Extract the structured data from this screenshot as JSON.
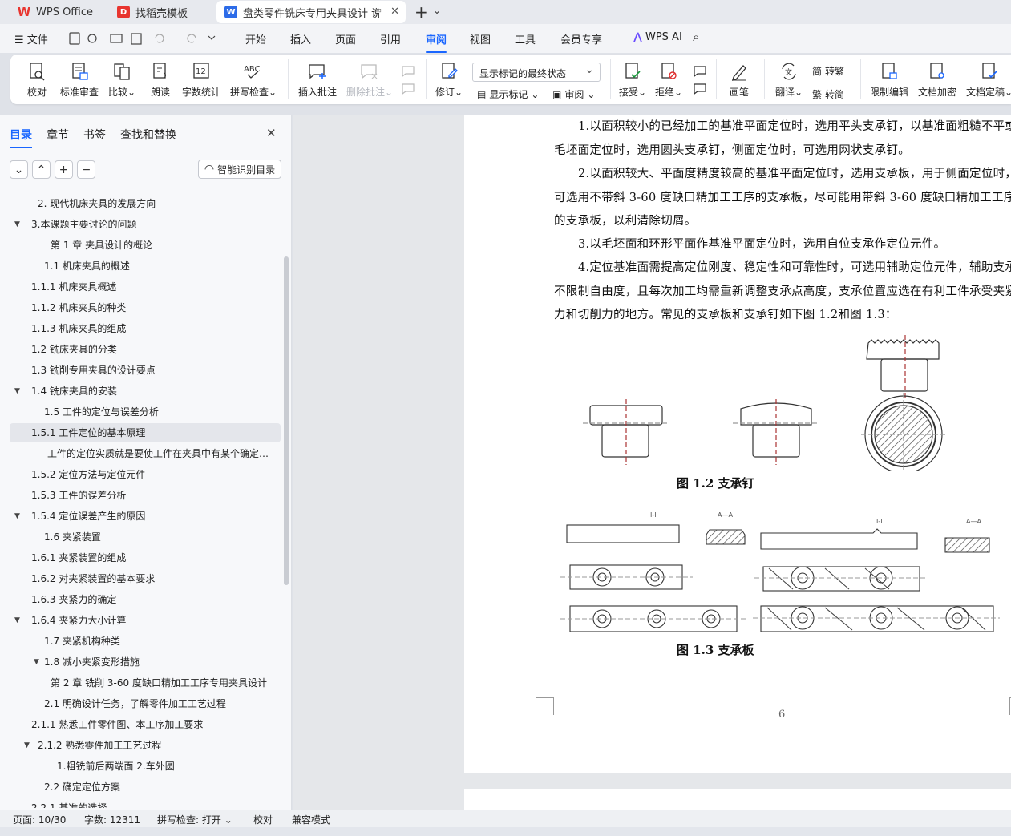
{
  "tabs": [
    {
      "label": "WPS Office",
      "icon": "wps-logo-icon",
      "color": "#e8352f"
    },
    {
      "label": "找稻壳模板",
      "icon": "docer-icon",
      "color": "#e8352f"
    },
    {
      "label": "盘类零件铣床专用夹具设计 说",
      "icon": "word-doc-icon",
      "color": "#2d6ce8"
    }
  ],
  "menu": {
    "file": "文件",
    "items": [
      "开始",
      "插入",
      "页面",
      "引用",
      "审阅",
      "视图",
      "工具",
      "会员专享"
    ],
    "active": "审阅",
    "ai": "WPS AI"
  },
  "ribbon": {
    "proof": "校对",
    "std_review": "标准审查",
    "compare": "比较",
    "read_aloud": "朗读",
    "word_count": "字数统计",
    "spell_check": "拼写检查",
    "insert_comment": "插入批注",
    "delete_comment": "删除批注",
    "revise": "修订",
    "markup_state": "显示标记的最终状态",
    "show_markup": "显示标记",
    "review": "审阅",
    "accept": "接受",
    "reject": "拒绝",
    "pen": "画笔",
    "translate": "翻译",
    "to_traditional": "转繁",
    "to_simplified": "转简",
    "restrict_edit": "限制编辑",
    "doc_encrypt": "文档加密",
    "doc_finalize": "文档定稿"
  },
  "nav": {
    "tabs": [
      "目录",
      "章节",
      "书签",
      "查找和替换"
    ],
    "active": "目录",
    "smart_btn": "智能识别目录",
    "toc": [
      {
        "text": "2. 现代机床夹具的发展方向",
        "indent": 2,
        "tw": ""
      },
      {
        "text": "3.本课题主要讨论的问题",
        "indent": 1,
        "tw": "▼"
      },
      {
        "text": "第 1 章  夹具设计的概论",
        "indent": 4,
        "tw": ""
      },
      {
        "text": "1.1  机床夹具的概述",
        "indent": 3,
        "tw": ""
      },
      {
        "text": "1.1.1    机床夹具概述",
        "indent": 1,
        "tw": ""
      },
      {
        "text": "1.1.2  机床夹具的种类",
        "indent": 1,
        "tw": ""
      },
      {
        "text": "1.1.3  机床夹具的组成",
        "indent": 1,
        "tw": ""
      },
      {
        "text": "1.2    铣床夹具的分类",
        "indent": 1,
        "tw": ""
      },
      {
        "text": "1.3  铣削专用夹具的设计要点",
        "indent": 1,
        "tw": ""
      },
      {
        "text": "1.4  铣床夹具的安装",
        "indent": 1,
        "tw": "▼"
      },
      {
        "text": "1.5  工件的定位与误差分析",
        "indent": 3,
        "tw": ""
      },
      {
        "text": "1.5.1  工件定位的基本原理",
        "indent": 1,
        "tw": "",
        "sel": true
      },
      {
        "text": "工件的定位实质就是要使工件在夹具中有某个确定的正确加工位置...",
        "indent": 3.5,
        "tw": ""
      },
      {
        "text": "1.5.2  定位方法与定位元件",
        "indent": 1,
        "tw": ""
      },
      {
        "text": "1.5.3  工件的误差分析",
        "indent": 1,
        "tw": ""
      },
      {
        "text": "1.5.4  定位误差产生的原因",
        "indent": 1,
        "tw": "▼"
      },
      {
        "text": "1.6  夹紧装置",
        "indent": 3,
        "tw": ""
      },
      {
        "text": "1.6.1 夹紧装置的组成",
        "indent": 1,
        "tw": ""
      },
      {
        "text": "1.6.2  对夹紧装置的基本要求",
        "indent": 1,
        "tw": ""
      },
      {
        "text": "1.6.3  夹紧力的确定",
        "indent": 1,
        "tw": ""
      },
      {
        "text": "1.6.4  夹紧力大小计算",
        "indent": 1,
        "tw": "▼"
      },
      {
        "text": "1.7  夹紧机构种类",
        "indent": 3,
        "tw": ""
      },
      {
        "text": "1.8  减小夹紧变形措施",
        "indent": 3,
        "tw": "▼"
      },
      {
        "text": "第 2 章   铣削 3-60 度缺口精加工工序专用夹具设计",
        "indent": 4,
        "tw": ""
      },
      {
        "text": "2.1  明确设计任务，了解零件加工工艺过程",
        "indent": 3,
        "tw": ""
      },
      {
        "text": "2.1.1  熟悉工件零件图、本工序加工要求",
        "indent": 1,
        "tw": ""
      },
      {
        "text": "2.1.2  熟悉零件加工工艺过程",
        "indent": 2,
        "tw": "▼"
      },
      {
        "text": "1.粗铣前后两端面            2.车外圆",
        "indent": 5,
        "tw": ""
      },
      {
        "text": "2.2  确定定位方案",
        "indent": 3,
        "tw": ""
      },
      {
        "text": "2.2.1  基准的选择",
        "indent": 1,
        "tw": ""
      }
    ]
  },
  "doc": {
    "paragraphs": [
      "1.以面积较小的已经加工的基准平面定位时，选用平头支承钉，以基准面粗糙不平或毛坯面定位时，选用圆头支承钉，侧面定位时，可选用网状支承钉。",
      "2.以面积较大、平面度精度较高的基准平面定位时，选用支承板，用于侧面定位时，可选用不带斜 3-60 度缺口精加工工序的支承板，尽可能用带斜 3-60 度缺口精加工工序的支承板，以利清除切屑。",
      "3.以毛坯面和环形平面作基准平面定位时，选用自位支承作定位元件。",
      "4.定位基准面需提高定位刚度、稳定性和可靠性时，可选用辅助定位元件，辅助支承不限制自由度，且每次加工均需重新调整支承点高度，支承位置应选在有利工件承受夹紧力和切削力的地方。常见的支承板和支承钉如下图 1.2和图 1.3："
    ],
    "caption1": "图 1.2  支承钉",
    "caption2": "图 1.3  支承板",
    "page_number": "6"
  },
  "status": {
    "page": "页面: 10/30",
    "words": "字数: 12311",
    "spell": "拼写检查: 打开",
    "proof": "校对",
    "compat": "兼容模式"
  }
}
